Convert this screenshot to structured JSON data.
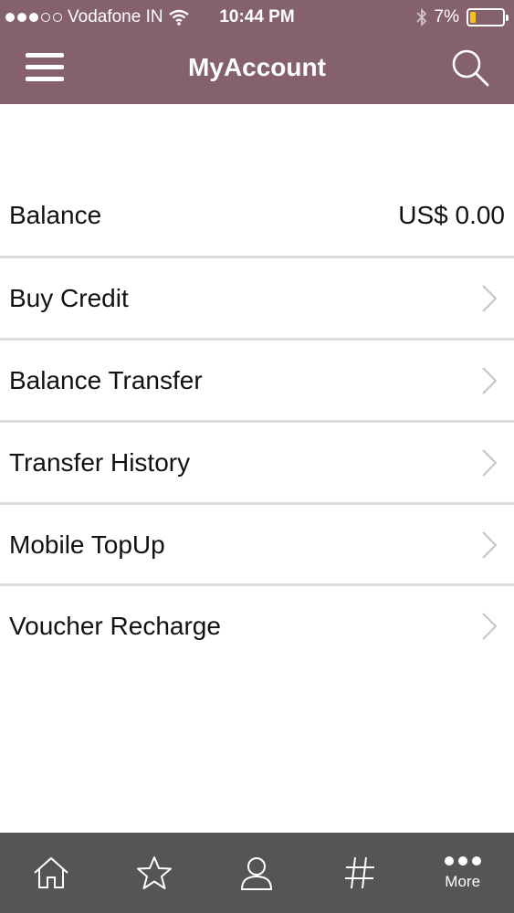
{
  "colors": {
    "brand": "#85606d",
    "tabbar": "#555555",
    "divider": "#dcdcdc",
    "battery": "#f2c21b"
  },
  "status_bar": {
    "carrier": "Vodafone IN",
    "time": "10:44 PM",
    "battery": "7%",
    "battery_level": 0.07
  },
  "header": {
    "title": "MyAccount"
  },
  "balance": {
    "label": "Balance",
    "value": "US$ 0.00"
  },
  "menu_items": [
    {
      "label": "Buy Credit"
    },
    {
      "label": "Balance Transfer"
    },
    {
      "label": "Transfer History"
    },
    {
      "label": "Mobile TopUp"
    },
    {
      "label": "Voucher Recharge"
    }
  ],
  "tab_bar": {
    "tabs": [
      {
        "icon": "home-icon"
      },
      {
        "icon": "star-icon"
      },
      {
        "icon": "profile-icon"
      },
      {
        "icon": "hash-icon"
      },
      {
        "icon": "more-icon",
        "label": "More"
      }
    ]
  }
}
